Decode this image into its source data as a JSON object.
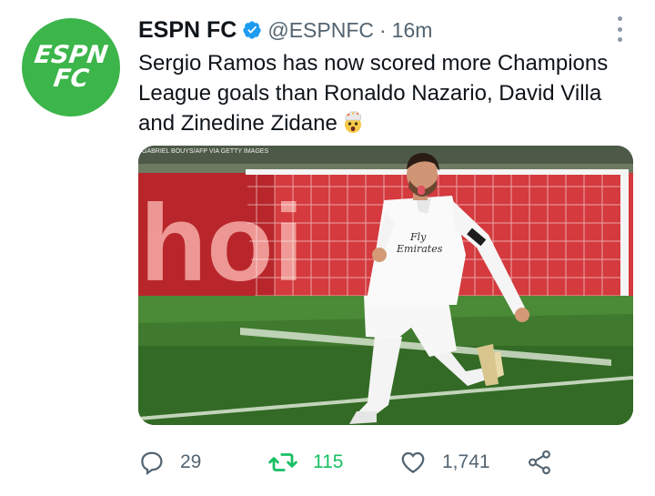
{
  "tweet": {
    "avatar_text_line1": "ESPN",
    "avatar_text_line2": "FC",
    "display_name": "ESPN FC",
    "handle": "@ESPNFC",
    "separator": "·",
    "time": "16m",
    "text": "Sergio Ramos has now scored more Champions League goals than Ronaldo Nazario, David Villa and Zidane",
    "text_lines": [
      "Sergio Ramos has now scored more Champions",
      "League goals than Ronaldo Nazario, David Villa",
      "and Zinedine Zidane"
    ],
    "emoji": "exploding-head-emoji",
    "media": {
      "photo_credit": "GABRIEL BOUYS/AFP VIA GETTY IMAGES",
      "jersey_sponsor_line1": "Fly",
      "jersey_sponsor_line2": "Emirates",
      "banner_text": "hoi"
    },
    "actions": {
      "reply_count": "29",
      "retweet_count": "115",
      "like_count": "1,741"
    }
  },
  "icons": {
    "verified": "verified-badge-icon",
    "more": "more-options-icon",
    "reply": "reply-icon",
    "retweet": "retweet-icon",
    "like": "heart-icon",
    "share": "share-icon"
  },
  "colors": {
    "brand_green": "#3cb54a",
    "verified_blue": "#1d9bf0",
    "retweet_green": "#17bf63",
    "secondary_text": "#536471"
  }
}
